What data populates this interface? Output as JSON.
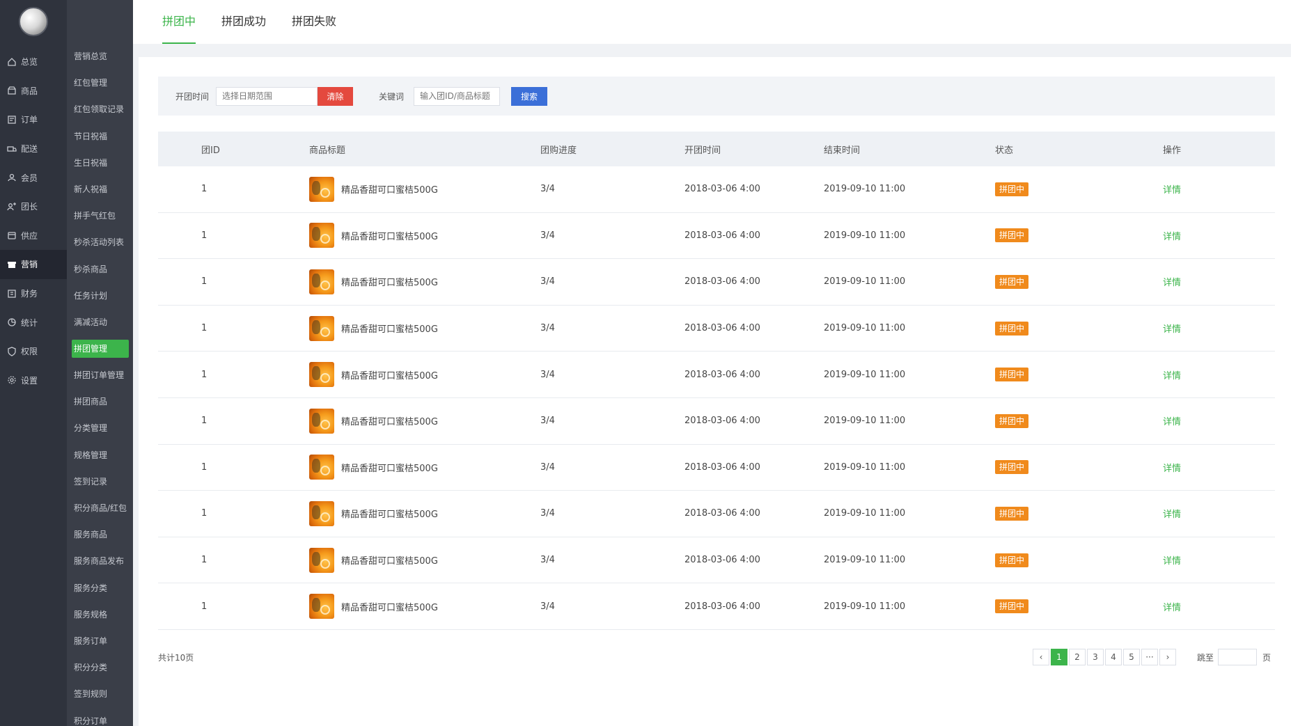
{
  "nav1": {
    "items": [
      {
        "label": "总览",
        "icon": "home-icon"
      },
      {
        "label": "商品",
        "icon": "shop-icon"
      },
      {
        "label": "订单",
        "icon": "order-icon"
      },
      {
        "label": "配送",
        "icon": "delivery-icon"
      },
      {
        "label": "会员",
        "icon": "user-icon"
      },
      {
        "label": "团长",
        "icon": "leader-icon"
      },
      {
        "label": "供应",
        "icon": "supply-icon"
      },
      {
        "label": "营销",
        "icon": "gift-icon"
      },
      {
        "label": "财务",
        "icon": "finance-icon"
      },
      {
        "label": "统计",
        "icon": "stats-icon"
      },
      {
        "label": "权限",
        "icon": "shield-icon"
      },
      {
        "label": "设置",
        "icon": "gear-icon"
      }
    ],
    "active": 7
  },
  "nav2": {
    "items": [
      "营销总览",
      "红包管理",
      "红包领取记录",
      "节日祝福",
      "生日祝福",
      "新人祝福",
      "拼手气红包",
      "秒杀活动列表",
      "秒杀商品",
      "任务计划",
      "满减活动",
      "拼团管理",
      "拼团订单管理",
      "拼团商品",
      "分类管理",
      "规格管理",
      "签到记录",
      "积分商品/红包",
      "服务商品",
      "服务商品发布",
      "服务分类",
      "服务规格",
      "服务订单",
      "积分分类",
      "签到规则",
      "积分订单"
    ],
    "active": 11
  },
  "tabs": [
    "拼团中",
    "拼团成功",
    "拼团失败"
  ],
  "filter": {
    "date_label": "开团时间",
    "date_placeholder": "选择日期范围",
    "clear_label": "清除",
    "keyword_label": "关键词",
    "keyword_placeholder": "输入团ID/商品标题",
    "search_label": "搜索"
  },
  "table": {
    "headers": [
      "团ID",
      "商品标题",
      "团购进度",
      "开团时间",
      "结束时间",
      "状态",
      "操作"
    ],
    "rows": [
      {
        "id": "1",
        "title": "精品香甜可口蜜桔500G",
        "progress": "3/4",
        "start": "2018-03-06 4:00",
        "end": "2019-09-10 11:00",
        "status": "拼团中",
        "action": "详情"
      },
      {
        "id": "1",
        "title": "精品香甜可口蜜桔500G",
        "progress": "3/4",
        "start": "2018-03-06 4:00",
        "end": "2019-09-10 11:00",
        "status": "拼团中",
        "action": "详情"
      },
      {
        "id": "1",
        "title": "精品香甜可口蜜桔500G",
        "progress": "3/4",
        "start": "2018-03-06 4:00",
        "end": "2019-09-10 11:00",
        "status": "拼团中",
        "action": "详情"
      },
      {
        "id": "1",
        "title": "精品香甜可口蜜桔500G",
        "progress": "3/4",
        "start": "2018-03-06 4:00",
        "end": "2019-09-10 11:00",
        "status": "拼团中",
        "action": "详情"
      },
      {
        "id": "1",
        "title": "精品香甜可口蜜桔500G",
        "progress": "3/4",
        "start": "2018-03-06 4:00",
        "end": "2019-09-10 11:00",
        "status": "拼团中",
        "action": "详情"
      },
      {
        "id": "1",
        "title": "精品香甜可口蜜桔500G",
        "progress": "3/4",
        "start": "2018-03-06 4:00",
        "end": "2019-09-10 11:00",
        "status": "拼团中",
        "action": "详情"
      },
      {
        "id": "1",
        "title": "精品香甜可口蜜桔500G",
        "progress": "3/4",
        "start": "2018-03-06 4:00",
        "end": "2019-09-10 11:00",
        "status": "拼团中",
        "action": "详情"
      },
      {
        "id": "1",
        "title": "精品香甜可口蜜桔500G",
        "progress": "3/4",
        "start": "2018-03-06 4:00",
        "end": "2019-09-10 11:00",
        "status": "拼团中",
        "action": "详情"
      },
      {
        "id": "1",
        "title": "精品香甜可口蜜桔500G",
        "progress": "3/4",
        "start": "2018-03-06 4:00",
        "end": "2019-09-10 11:00",
        "status": "拼团中",
        "action": "详情"
      },
      {
        "id": "1",
        "title": "精品香甜可口蜜桔500G",
        "progress": "3/4",
        "start": "2018-03-06 4:00",
        "end": "2019-09-10 11:00",
        "status": "拼团中",
        "action": "详情"
      }
    ]
  },
  "footer": {
    "total": "共计10页",
    "pages": [
      "1",
      "2",
      "3",
      "4",
      "5",
      "···"
    ],
    "current_page": "1",
    "jump_label": "跳至",
    "unit": "页"
  },
  "colors": {
    "accent": "#3cb44b",
    "danger": "#e4493e",
    "primary": "#3b6fd8",
    "badge": "#f08a1c",
    "sidebar": "#2f333d",
    "sidebar2": "#3a3e48"
  }
}
